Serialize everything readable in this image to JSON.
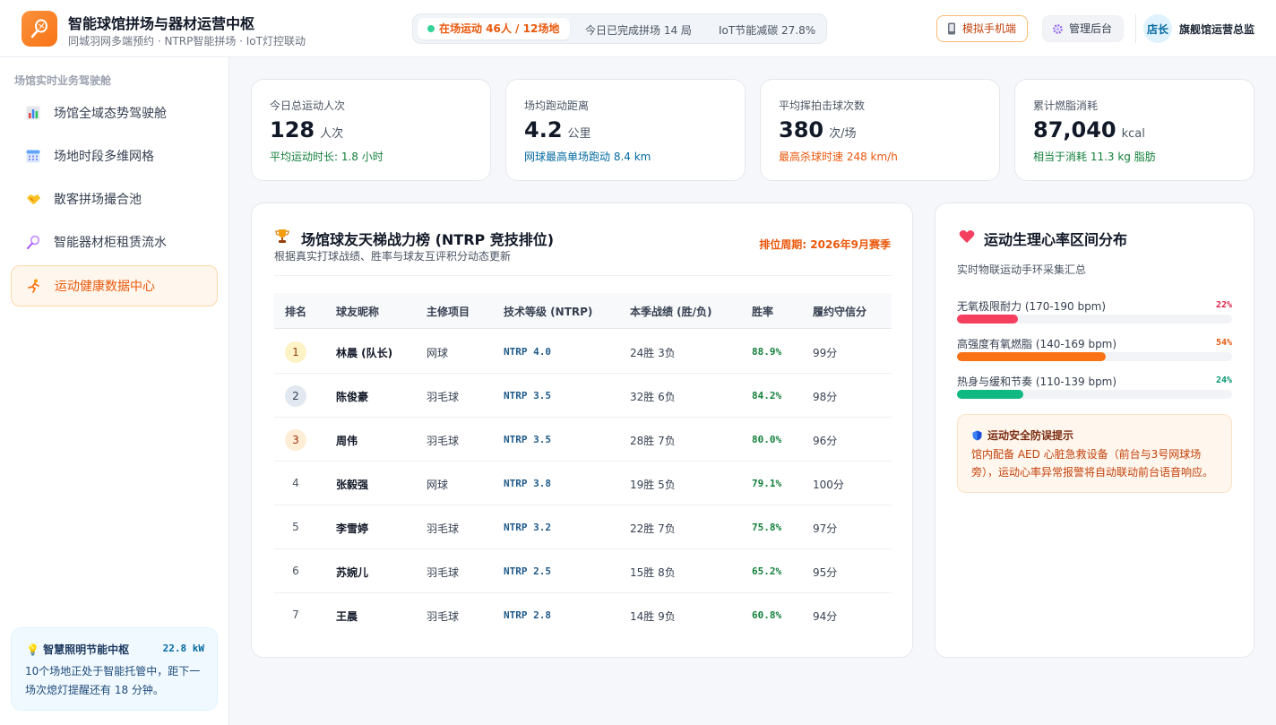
{
  "header": {
    "title": "智能球馆拼场与器材运营中枢",
    "subtitle": "同城羽网多端预约 · NTRP智能拼场 · IoT灯控联动",
    "status_active": "在场运动 46人 / 12场地",
    "status_games": "今日已完成拼场 14 局",
    "status_iot": "IoT节能减碳 27.8%",
    "btn_simulate": "模拟手机端",
    "btn_admin": "管理后台",
    "avatar_text": "店长",
    "user_name": "旗舰馆运营总监"
  },
  "sidebar": {
    "group_title": "场馆实时业务驾驶舱",
    "items": [
      {
        "label": "场馆全域态势驾驶舱",
        "icon": "bar-chart-icon"
      },
      {
        "label": "场地时段多维网格",
        "icon": "calendar-icon"
      },
      {
        "label": "散客拼场撮合池",
        "icon": "handshake-icon"
      },
      {
        "label": "智能器材柜租赁流水",
        "icon": "racket-icon"
      },
      {
        "label": "运动健康数据中心",
        "icon": "runner-icon",
        "active": true
      }
    ],
    "energy": {
      "title": "智慧照明节能中枢",
      "value": "22.8 kW",
      "desc": "10个场地正处于智能托管中，距下一场次熄灯提醒还有 18 分钟。"
    }
  },
  "kpis": [
    {
      "label": "今日总运动人次",
      "value": "128",
      "unit": "人次",
      "note": "平均运动时长: 1.8 小时",
      "note_color": "#15803d"
    },
    {
      "label": "场均跑动距离",
      "value": "4.2",
      "unit": "公里",
      "note": "网球最高单场跑动 8.4 km",
      "note_color": "#0369a1"
    },
    {
      "label": "平均挥拍击球次数",
      "value": "380",
      "unit": "次/场",
      "note": "最高杀球时速 248 km/h",
      "note_color": "#ea580c"
    },
    {
      "label": "累计燃脂消耗",
      "value": "87,040",
      "unit": "kcal",
      "note": "相当于消耗 11.3 kg 脂肪",
      "note_color": "#15803d"
    }
  ],
  "leaderboard": {
    "title": "场馆球友天梯战力榜 (NTRP 竞技排位)",
    "subtitle": "根据真实打球战绩、胜率与球友互评积分动态更新",
    "period": "排位周期: 2026年9月赛季",
    "columns": [
      "排名",
      "球友昵称",
      "主修项目",
      "技术等级 (NTRP)",
      "本季战绩 (胜/负)",
      "胜率",
      "履约守信分"
    ],
    "rows": [
      {
        "rank": "1",
        "name": "林晨 (队长)",
        "sport": "网球",
        "ntrp": "NTRP 4.0",
        "record": "24胜  3负",
        "win": "88.9%",
        "credit": "99分"
      },
      {
        "rank": "2",
        "name": "陈俊豪",
        "sport": "羽毛球",
        "ntrp": "NTRP 3.5",
        "record": "32胜  6负",
        "win": "84.2%",
        "credit": "98分"
      },
      {
        "rank": "3",
        "name": "周伟",
        "sport": "羽毛球",
        "ntrp": "NTRP 3.5",
        "record": "28胜  7负",
        "win": "80.0%",
        "credit": "96分"
      },
      {
        "rank": "4",
        "name": "张毅强",
        "sport": "网球",
        "ntrp": "NTRP 3.8",
        "record": "19胜  5负",
        "win": "79.1%",
        "credit": "100分"
      },
      {
        "rank": "5",
        "name": "李雪婷",
        "sport": "羽毛球",
        "ntrp": "NTRP 3.2",
        "record": "22胜  7负",
        "win": "75.8%",
        "credit": "97分"
      },
      {
        "rank": "6",
        "name": "苏婉儿",
        "sport": "羽毛球",
        "ntrp": "NTRP 2.5",
        "record": "15胜  8负",
        "win": "65.2%",
        "credit": "95分"
      },
      {
        "rank": "7",
        "name": "王晨",
        "sport": "羽毛球",
        "ntrp": "NTRP 2.8",
        "record": "14胜  9负",
        "win": "60.8%",
        "credit": "94分"
      }
    ]
  },
  "heart_rate": {
    "title": "运动生理心率区间分布",
    "subtitle": "实时物联运动手环采集汇总",
    "zones": [
      {
        "label": "无氧极限耐力 (170-190 bpm)",
        "pct": "22%",
        "fraction": 0.22,
        "color": "#f43f5e",
        "pct_color": "#e11d48"
      },
      {
        "label": "高强度有氧燃脂 (140-169 bpm)",
        "pct": "54%",
        "fraction": 0.54,
        "color": "#f97316",
        "pct_color": "#ea580c"
      },
      {
        "label": "热身与缓和节奏 (110-139 bpm)",
        "pct": "24%",
        "fraction": 0.24,
        "color": "#10b981",
        "pct_color": "#059669"
      }
    ],
    "safety": {
      "title": "运动安全防误提示",
      "desc": "馆内配备 AED 心脏急救设备（前台与3号网球场旁），运动心率异常报警将自动联动前台语音响应。"
    }
  }
}
